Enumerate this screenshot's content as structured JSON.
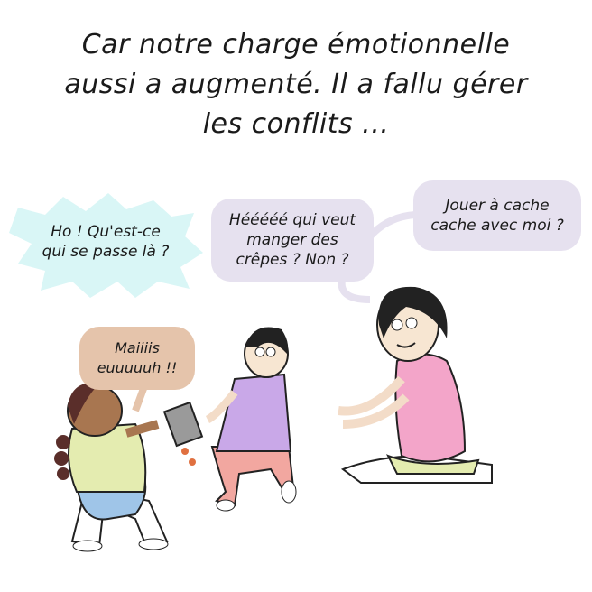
{
  "caption": {
    "lines": [
      "Car notre charge émotionnelle",
      "aussi a augmenté. Il a fallu gérer",
      "les conflits ..."
    ]
  },
  "bubbles": {
    "exclaim": {
      "lines": [
        "Ho ! Qu'est-ce",
        "qui se passe là ?"
      ],
      "color": "#d9f6f6"
    },
    "crepes": {
      "lines": [
        "Hééééé qui veut",
        "manger des",
        "crêpes ? Non ?"
      ],
      "color": "#e6e1ef"
    },
    "hide": {
      "lines": [
        "Jouer à cache",
        "cache avec moi ?"
      ],
      "color": "#e6e1ef"
    },
    "girl": {
      "lines": [
        "Maiiiis",
        "euuuuuh !!"
      ],
      "color": "#e5c4ab"
    }
  }
}
